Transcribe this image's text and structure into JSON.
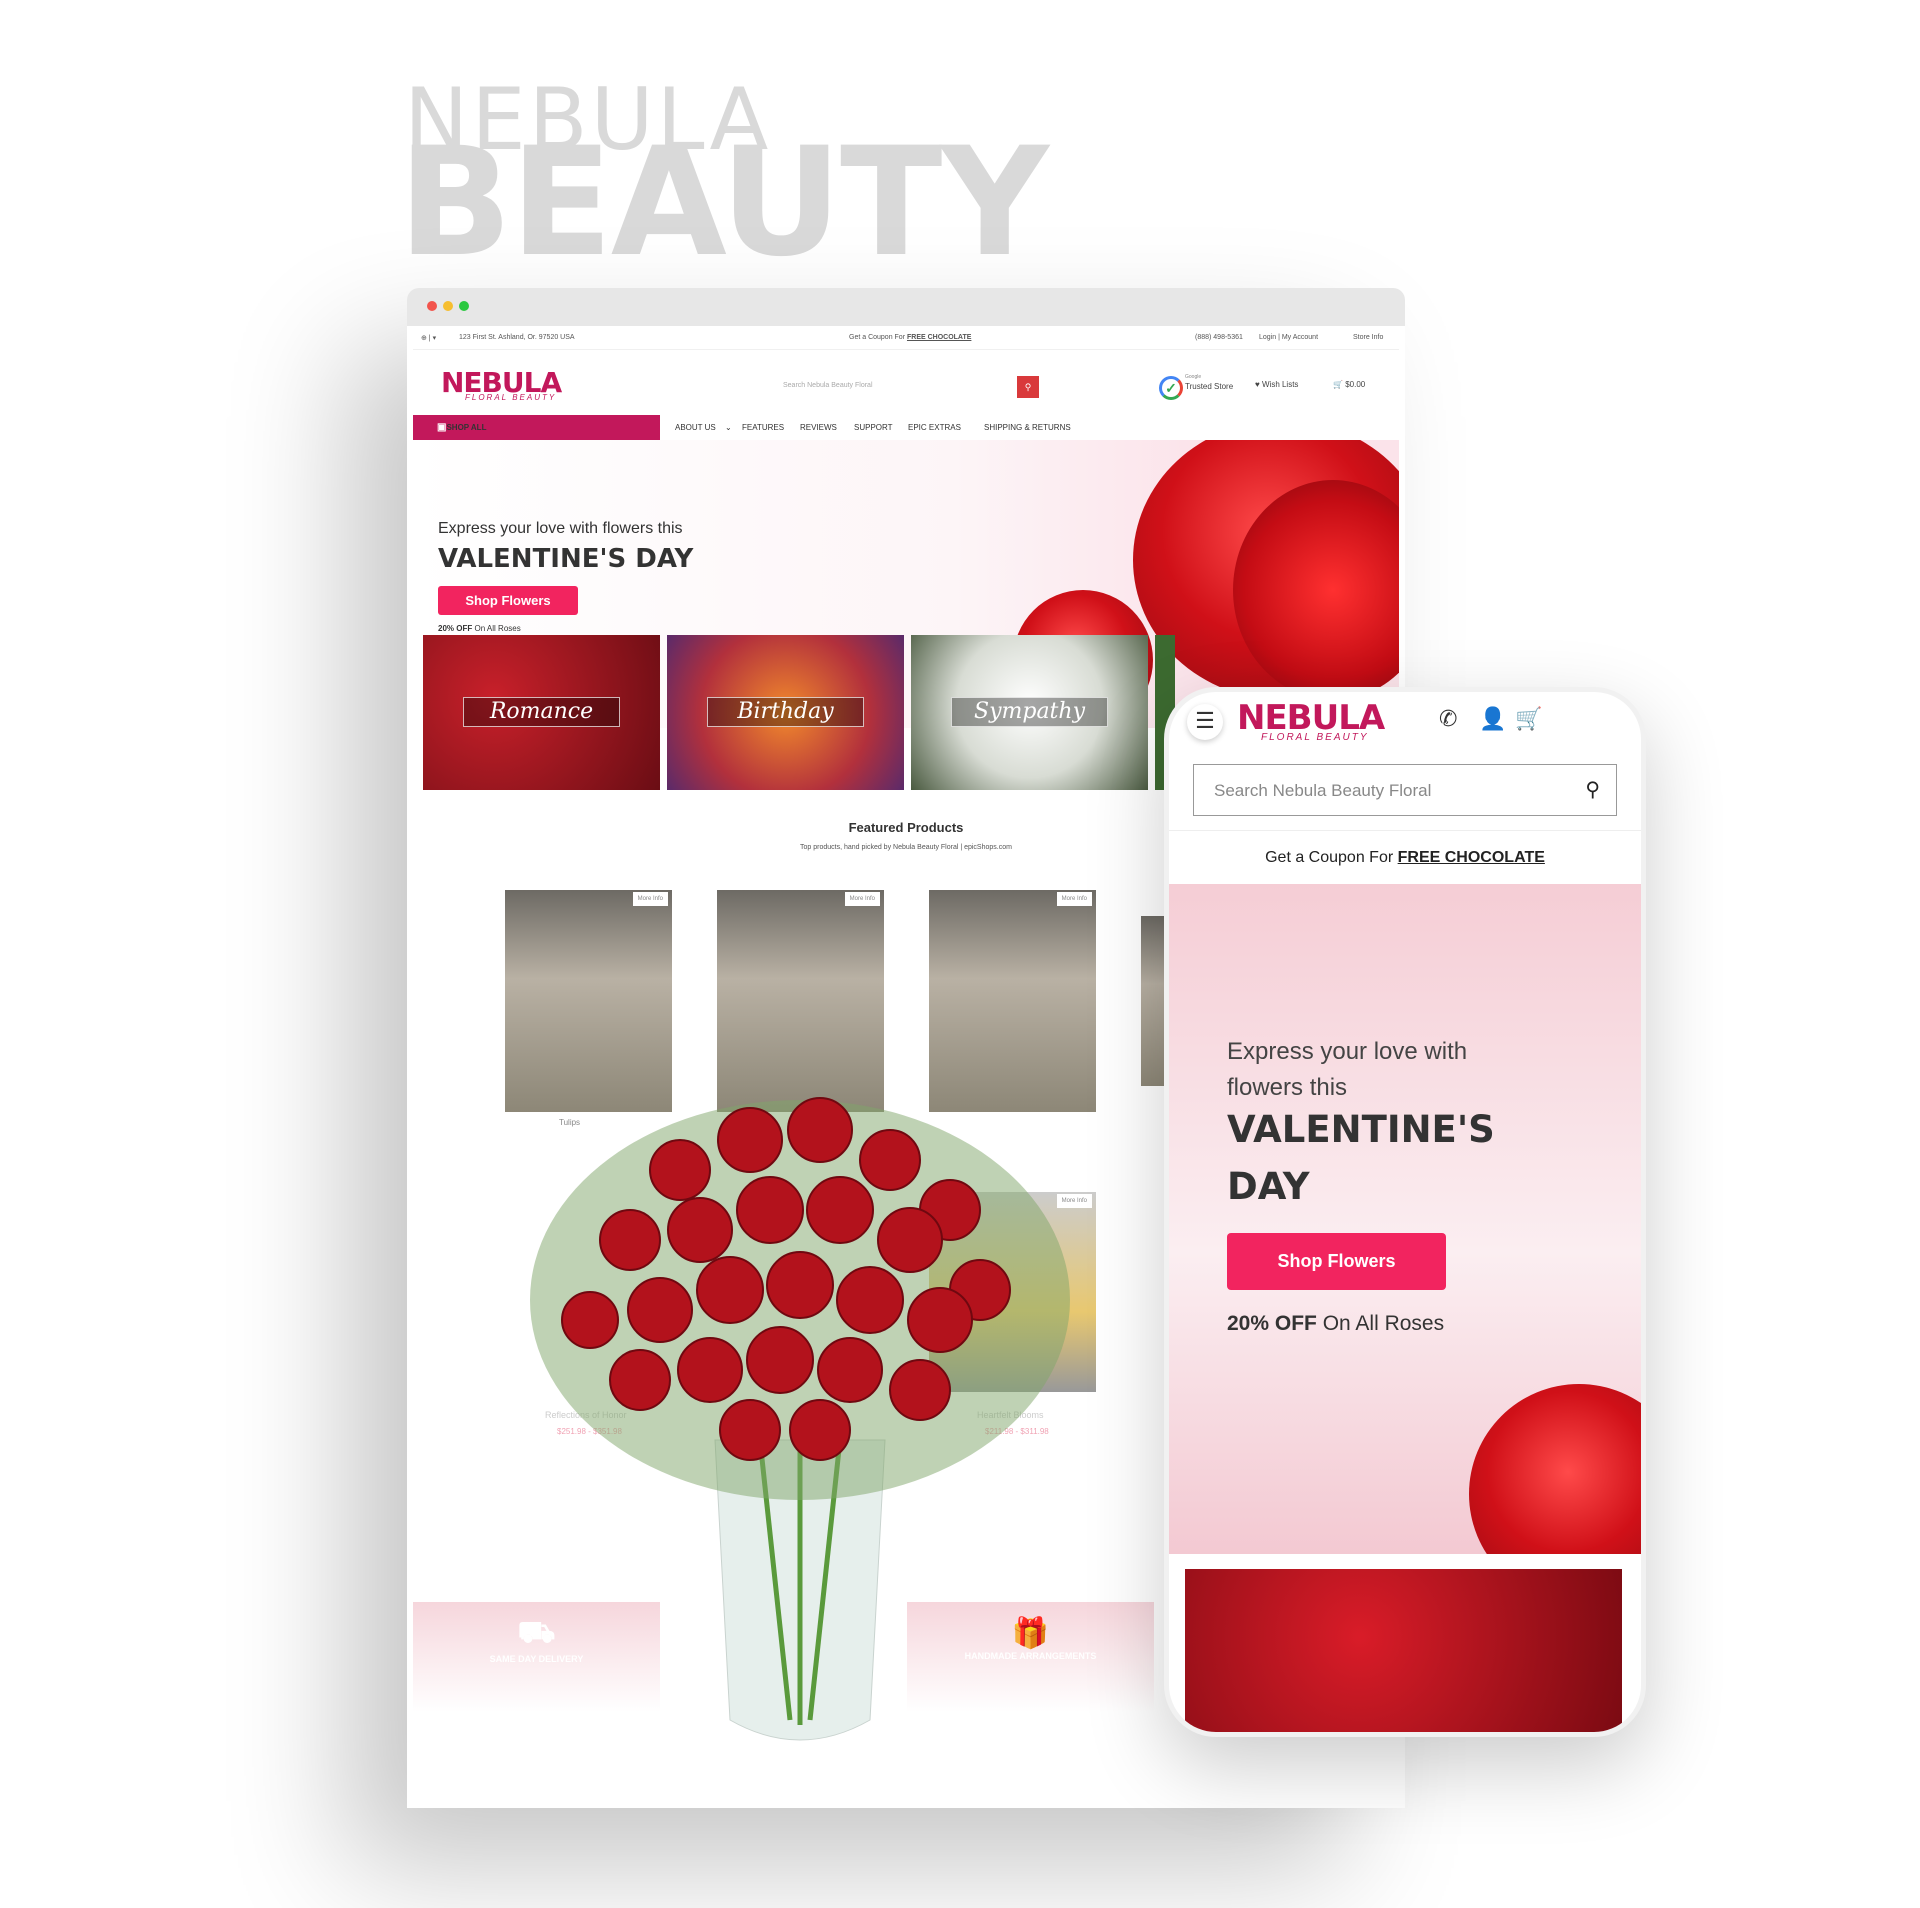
{
  "showcase": {
    "title_line1": "NEBULA",
    "title_line2": "BEAUTY"
  },
  "desktop": {
    "topbar": {
      "address": "123 First St. Ashland, Or. 97520 USA",
      "coupon_prefix": "Get a Coupon For",
      "coupon_link": "FREE CHOCOLATE",
      "phone": "(888) 498-5361",
      "login": "Login | My Account",
      "store_info": "Store Info"
    },
    "header": {
      "logo": "NEBULA",
      "logo_sub": "FLORAL BEAUTY",
      "search_placeholder": "Search Nebula Beauty Floral",
      "trusted_small": "Google",
      "trusted": "Trusted Store",
      "wishlist": "Wish Lists",
      "cart_total": "$0.00"
    },
    "nav": {
      "shop_all": "SHOP ALL",
      "items": [
        "ABOUT US",
        "FEATURES",
        "REVIEWS",
        "SUPPORT",
        "EPIC EXTRAS",
        "SHIPPING & RETURNS"
      ]
    },
    "hero": {
      "line1": "Express your love with flowers this",
      "headline": "VALENTINE'S DAY",
      "button": "Shop Flowers",
      "offer_bold": "20% OFF",
      "offer_rest": "On All Roses"
    },
    "categories": [
      "Romance",
      "Birthday",
      "Sympathy"
    ],
    "featured": {
      "title": "Featured Products",
      "subtitle": "Top products, hand picked by Nebula Beauty Floral | epicShops.com",
      "more_info": "More Info",
      "products": [
        {
          "name": "Tulips"
        },
        {
          "name": "Reflections of Honor",
          "price": "$251.98 - $351.98"
        },
        {
          "name": "Heartfelt Blooms",
          "price": "$211.98 - $311.98"
        }
      ]
    },
    "features": [
      "SAME DAY DELIVERY",
      "HANDMADE ARRANGEMENTS"
    ]
  },
  "mobile": {
    "logo": "NEBULA",
    "logo_sub": "FLORAL BEAUTY",
    "search_placeholder": "Search Nebula Beauty Floral",
    "coupon_prefix": "Get a Coupon For",
    "coupon_link": "FREE CHOCOLATE",
    "hero": {
      "line1": "Express your love with flowers this",
      "headline1": "VALENTINE'S",
      "headline2": "DAY",
      "button": "Shop Flowers",
      "offer_bold": "20% OFF",
      "offer_rest": "On All Roses"
    }
  },
  "colors": {
    "brand": "#c2185b",
    "button": "#f2245f",
    "search_button": "#d9393b"
  }
}
